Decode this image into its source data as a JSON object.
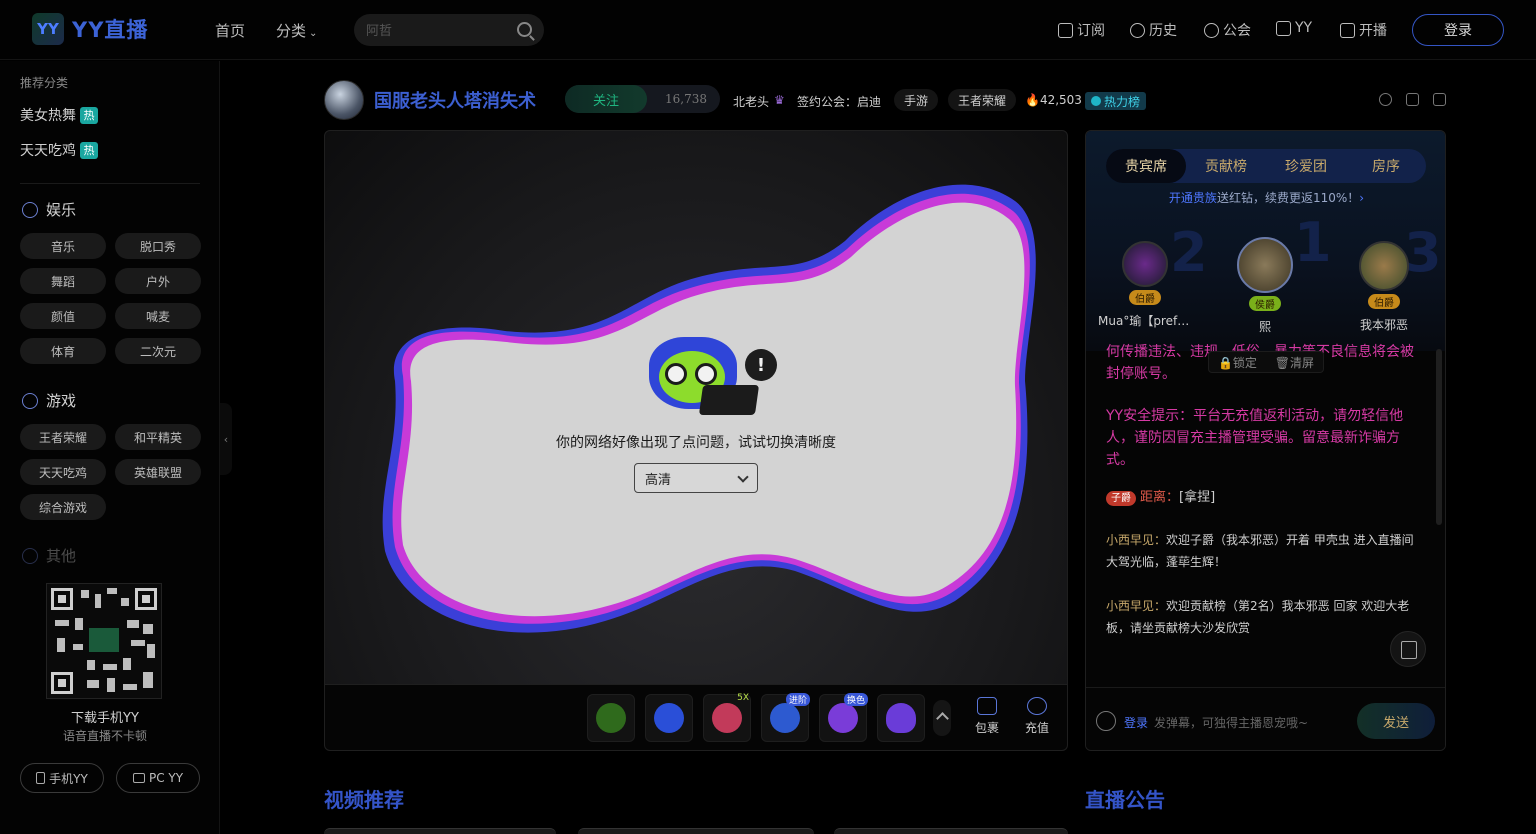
{
  "header": {
    "logo_badge": "YY",
    "logo_text": "YY直播",
    "nav": [
      {
        "label": "首页"
      },
      {
        "label": "分类"
      }
    ],
    "search": {
      "placeholder": "阿哲"
    },
    "right_links": [
      {
        "label": "订阅",
        "icon": "bookmark-icon"
      },
      {
        "label": "历史",
        "icon": "clock-icon"
      },
      {
        "label": "公会",
        "icon": "guild-icon"
      },
      {
        "label": "YY",
        "icon": "chart-icon"
      },
      {
        "label": "开播",
        "icon": "camera-icon"
      }
    ],
    "login": "登录"
  },
  "sidebar": {
    "recommend_title": "推荐分类",
    "hot_items": [
      {
        "label": "美女热舞",
        "badge": "热"
      },
      {
        "label": "天天吃鸡",
        "badge": "热"
      }
    ],
    "sections": [
      {
        "title": "娱乐",
        "chips": [
          "音乐",
          "脱口秀",
          "舞蹈",
          "户外",
          "颜值",
          "喊麦",
          "体育",
          "二次元"
        ]
      },
      {
        "title": "游戏",
        "chips": [
          "王者荣耀",
          "和平精英",
          "天天吃鸡",
          "英雄联盟",
          "综合游戏"
        ]
      },
      {
        "title": "其他",
        "chips": []
      }
    ],
    "download": {
      "title": "下载手机YY",
      "subtitle": "语音直播不卡顿",
      "buttons": [
        "手机YY",
        "PC YY"
      ]
    }
  },
  "room": {
    "title": "国服老头人塔消失术",
    "follow_label": "关注",
    "follow_count": "16,738",
    "host": "北老头",
    "guild": "签约公会：启迪",
    "tags": [
      "手游",
      "王者荣耀"
    ],
    "heat": "42,503",
    "heat_badge": "热力榜"
  },
  "player": {
    "error_message": "你的网络好像出现了点问题，试试切换清晰度",
    "quality": "高清",
    "mascot_alert": "!"
  },
  "gifts": {
    "items": [
      {
        "name": "gift-1",
        "color": "#2f6a1c",
        "badge": ""
      },
      {
        "name": "gift-2",
        "color": "#2a4fd8",
        "badge": ""
      },
      {
        "name": "gift-3",
        "color": "#c23a5a",
        "badge": "5X"
      },
      {
        "name": "gift-4",
        "color": "#2d5ad0",
        "badge": "进阶"
      },
      {
        "name": "gift-5",
        "color": "#7a3cd8",
        "badge": "换色"
      },
      {
        "name": "gift-6",
        "color": "#6a3cd8",
        "badge": ""
      }
    ],
    "bag_label": "包裹",
    "recharge_label": "充值"
  },
  "right_panel": {
    "tabs": [
      "贵宾席",
      "贡献榜",
      "珍爱团",
      "房序"
    ],
    "active_tab": 0,
    "vip_prefix": "开通贵族",
    "vip_suffix": "送红钻，续费更返110%！",
    "ranks": [
      {
        "name": "Mua°瑜【prefere...",
        "badge": "伯爵",
        "num": "2"
      },
      {
        "name": "熙",
        "badge": "侯爵",
        "num": "1"
      },
      {
        "name": "我本邪恶",
        "badge": "伯爵",
        "num": "3"
      }
    ],
    "lock_label": "锁定",
    "clear_label": "清屏",
    "chat": {
      "sys1": "何传播违法、违规、低俗、暴力等不良信息将会被封停账号。",
      "sys2": "YY安全提示：平台无充值返利活动，请勿轻信他人，谨防因冒充主播管理受骗。留意最新诈骗方式。",
      "msg1_badge": "子爵",
      "msg1_user": "距离",
      "msg1_text": "[拿捏]",
      "msg2_user": "小西早见",
      "msg2_text": "欢迎子爵（我本邪恶）开着 甲壳虫 进入直播间 大驾光临，蓬荜生辉！",
      "msg3_user": "小西早见",
      "msg3_text": "欢迎贡献榜（第2名）我本邪恶  回家  欢迎大老板，请坐贡献榜大沙发欣赏"
    },
    "input_login": "登录",
    "input_placeholder": "发弹幕，可独得主播恩宠哦~",
    "send_label": "发送"
  },
  "sections": {
    "video_rec": "视频推荐",
    "announcement": "直播公告"
  }
}
